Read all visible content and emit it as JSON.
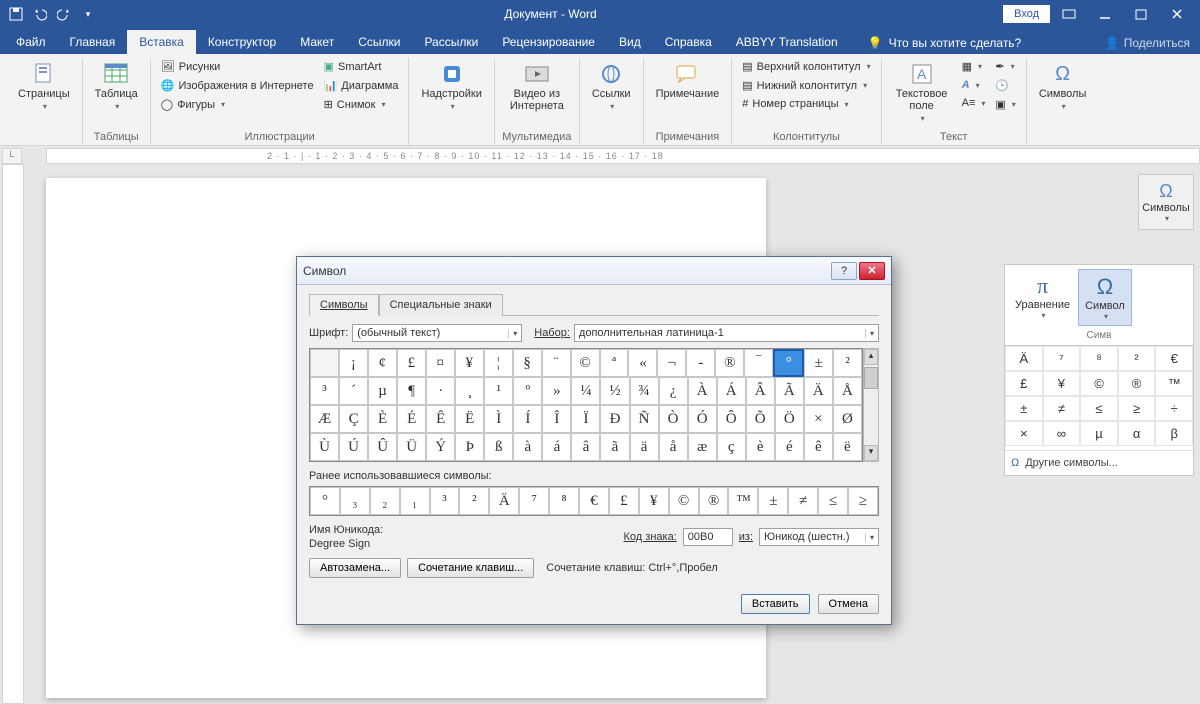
{
  "titlebar": {
    "title": "Документ  -  Word",
    "login": "Вход"
  },
  "menutabs": [
    "Файл",
    "Главная",
    "Вставка",
    "Конструктор",
    "Макет",
    "Ссылки",
    "Рассылки",
    "Рецензирование",
    "Вид",
    "Справка",
    "ABBYY Translation"
  ],
  "active_tab": 2,
  "tell_me": "Что вы хотите сделать?",
  "share": "Поделиться",
  "ribbon": {
    "pages": {
      "btn": "Страницы",
      "label": ""
    },
    "tables": {
      "btn": "Таблица",
      "label": "Таблицы"
    },
    "illustr": {
      "items": [
        "Рисунки",
        "Изображения в Интернете",
        "Фигуры",
        "SmartArt",
        "Диаграмма",
        "Снимок"
      ],
      "label": "Иллюстрации"
    },
    "addins": {
      "btn": "Надстройки",
      "label": ""
    },
    "media": {
      "btn": "Видео из Интернета",
      "label": "Мультимедиа"
    },
    "links": {
      "btn": "Ссылки",
      "label": ""
    },
    "comment": {
      "btn": "Примечание",
      "label": "Примечания"
    },
    "hf": {
      "items": [
        "Верхний колонтитул",
        "Нижний колонтитул",
        "Номер страницы"
      ],
      "label": "Колонтитулы"
    },
    "text": {
      "btn": "Текстовое поле",
      "label": "Текст"
    },
    "symbols": {
      "btn": "Символы",
      "label": ""
    }
  },
  "ruler": "2 · 1 · | · 1 · 2 · 3 · 4 · 5 · 6 · 7 · 8 · 9 · 10 · 11 · 12 · 13 · 14 · 15 · 16 · 17 · 18",
  "side_panel": {
    "head": "Символы",
    "eq": "Уравнение",
    "sym": "Символ",
    "group": "Симв",
    "grid": [
      "Ä",
      "⁷",
      "⁸",
      "²",
      "€",
      "£",
      "¥",
      "©",
      "®",
      "™",
      "±",
      "≠",
      "≤",
      "≥",
      "÷",
      "×",
      "∞",
      "µ",
      "α",
      "β"
    ],
    "more": "Другие символы..."
  },
  "dialog": {
    "title": "Символ",
    "tabs": [
      "Символы",
      "Специальные знаки"
    ],
    "font_label": "Шрифт:",
    "font_value": "(обычный текст)",
    "set_label": "Набор:",
    "set_value": "дополнительная латиница-1",
    "grid": [
      [
        "",
        "¡",
        "¢",
        "£",
        "¤",
        "¥",
        "¦",
        "§",
        "¨",
        "©",
        "ª",
        "«",
        "¬",
        "-",
        "®",
        "‾",
        "°",
        "±",
        "²"
      ],
      [
        "³",
        "´",
        "µ",
        "¶",
        "·",
        "¸",
        "¹",
        "º",
        "»",
        "¼",
        "½",
        "¾",
        "¿",
        "À",
        "Á",
        "Â",
        "Ã",
        "Ä",
        "Å"
      ],
      [
        "Æ",
        "Ç",
        "È",
        "É",
        "Ê",
        "Ë",
        "Ì",
        "Í",
        "Î",
        "Ï",
        "Ð",
        "Ñ",
        "Ò",
        "Ó",
        "Ô",
        "Õ",
        "Ö",
        "×",
        "Ø"
      ],
      [
        "Ù",
        "Ú",
        "Û",
        "Ü",
        "Ý",
        "Þ",
        "ß",
        "à",
        "á",
        "â",
        "ã",
        "ä",
        "å",
        "æ",
        "ç",
        "è",
        "é",
        "ê",
        "ë"
      ]
    ],
    "selected": [
      0,
      16
    ],
    "recent_label": "Ранее использовавшиеся символы:",
    "recent": [
      "°",
      "₃",
      "₂",
      "₁",
      "³",
      "²",
      "Ä",
      "⁷",
      "⁸",
      "€",
      "£",
      "¥",
      "©",
      "®",
      "™",
      "±",
      "≠",
      "≤",
      "≥"
    ],
    "uni_label": "Имя Юникода:",
    "uni_name": "Degree Sign",
    "code_label": "Код знака:",
    "code_value": "00B0",
    "from_label": "из:",
    "from_value": "Юникод (шестн.)",
    "autocorrect": "Автозамена...",
    "shortcut": "Сочетание клавиш...",
    "shortcut_info": "Сочетание клавиш: Ctrl+°,Пробел",
    "insert": "Вставить",
    "cancel": "Отмена"
  }
}
